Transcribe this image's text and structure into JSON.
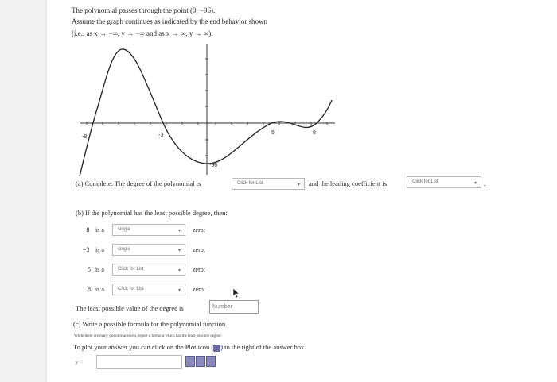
{
  "intro": {
    "line1": "The polynomial passes through the point (0, −96).",
    "line2": "Assume the graph continues as indicated by the end behavior shown",
    "line3": "(i.e., as x → −∞, y → −∞ and as x → ∞, y → ∞)."
  },
  "graph": {
    "x_ticks": [
      "-8",
      "-3",
      "5",
      "8"
    ],
    "y_label": "-96"
  },
  "part_a": {
    "prefix": "(a) Complete: The degree of the polynomial is",
    "degree_select": "Click for List",
    "middle": "and the leading coefficient is",
    "coef_select": "Click for List",
    "suffix": "."
  },
  "part_b": {
    "intro": "(b) If the polynomial has the least possible degree, then:",
    "rows": [
      {
        "root": "−8",
        "is_a": "is a",
        "value": "single",
        "zero": "zero;"
      },
      {
        "root": "−3",
        "is_a": "is a",
        "value": "single",
        "zero": "zero;"
      },
      {
        "root": "5",
        "is_a": "is a",
        "value": "Click for List",
        "zero": "zero;"
      },
      {
        "root": "8",
        "is_a": "is a",
        "value": "Click for List",
        "zero": "zero."
      }
    ],
    "least_label": "The least possible value of the degree is",
    "least_placeholder": "Number"
  },
  "part_c": {
    "prompt": "(c) Write a possible formula for the polynomial function.",
    "note": "While there are many possible answers, report a formula which has the least possible degree.",
    "plot_text_before": "To plot your answer you can click on the Plot icon (",
    "plot_text_after": ") to the right of the answer box.",
    "y_label": "y ="
  }
}
